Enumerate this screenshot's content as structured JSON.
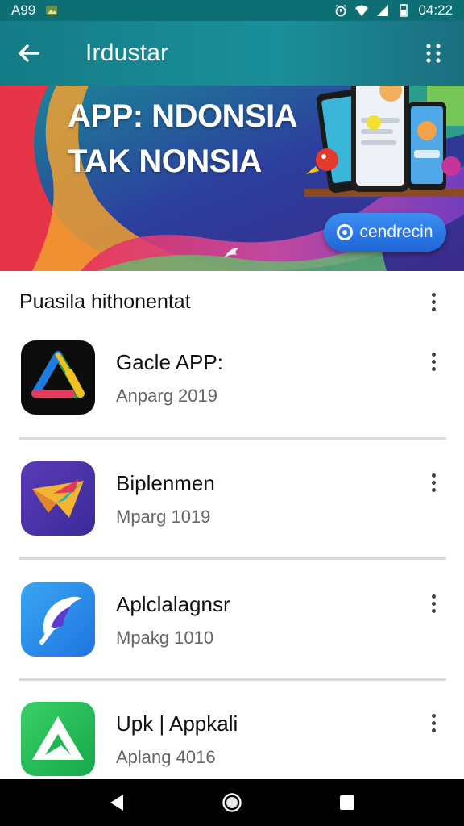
{
  "status_bar": {
    "left_text": "A99",
    "time": "04:22"
  },
  "app_bar": {
    "title": "Irdustar",
    "back_icon": "arrow-back-icon",
    "overflow_icon": "more-vert-icon"
  },
  "banner": {
    "headline_line1": "APP: NDONSIA",
    "headline_line2": "TAK NONSIA",
    "cta_label": "cendrecin"
  },
  "section": {
    "title": "Puasila hithonentat"
  },
  "apps": [
    {
      "name": "Gacle APP:",
      "subtitle": "Anparg 2019",
      "icon": "delta-logo-icon"
    },
    {
      "name": "Biplenmen",
      "subtitle": "Mparg 1019",
      "icon": "paper-plane-logo-icon"
    },
    {
      "name": "Aplclalagnsr",
      "subtitle": "Mpakg 1010",
      "icon": "stylized-p-logo-icon"
    },
    {
      "name": "Upk | Appkali",
      "subtitle": "Aplang 4016",
      "icon": "triangle-a-logo-icon"
    }
  ],
  "nav": {
    "back_icon": "nav-back-icon",
    "home_icon": "nav-home-icon",
    "recents_icon": "nav-recents-icon"
  },
  "colors": {
    "app_bar": "#147c86",
    "cta": "#2a78e4",
    "nav_bar": "#000000"
  }
}
